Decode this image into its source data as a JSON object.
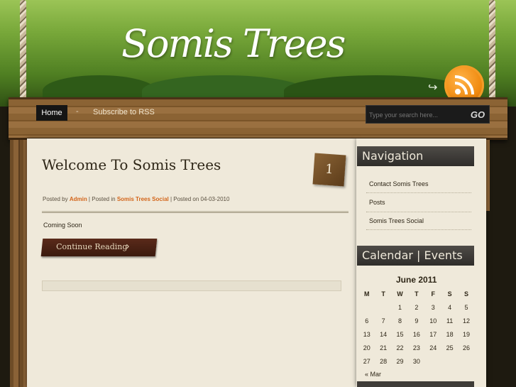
{
  "header": {
    "site_title": "Somis Trees"
  },
  "nav": {
    "home": "Home",
    "separator": "-",
    "rss": "Subscribe to RSS"
  },
  "search": {
    "placeholder": "Type your search here...",
    "go_label": "GO"
  },
  "post": {
    "title": "Welcome To Somis Trees",
    "comment_count": "1",
    "meta_posted_by": "Posted by ",
    "meta_author": "Admin",
    "meta_posted_in": " | Posted in ",
    "meta_category": "Somis Trees Social",
    "meta_posted_on": " | Posted on 04-03-2010",
    "excerpt": "Coming Soon",
    "continue_label": "Continue Reading",
    "continue_arrow": "›"
  },
  "sidebar": {
    "navigation_title": "Navigation",
    "links": [
      "Contact Somis Trees",
      "Posts",
      "Somis Trees Social"
    ],
    "calendar_title": "Calendar | Events"
  },
  "calendar": {
    "caption": "June 2011",
    "days": [
      "M",
      "T",
      "W",
      "T",
      "F",
      "S",
      "S"
    ],
    "weeks": [
      [
        "",
        "",
        "1",
        "2",
        "3",
        "4",
        "5"
      ],
      [
        "6",
        "7",
        "8",
        "9",
        "10",
        "11",
        "12"
      ],
      [
        "13",
        "14",
        "15",
        "16",
        "17",
        "18",
        "19"
      ],
      [
        "20",
        "21",
        "22",
        "23",
        "24",
        "25",
        "26"
      ],
      [
        "27",
        "28",
        "29",
        "30",
        "",
        "",
        ""
      ]
    ],
    "prev": "« Mar"
  },
  "colors": {
    "accent_orange": "#d3651a",
    "header_green": "#6b9a2e",
    "nav_dark": "#151515"
  }
}
